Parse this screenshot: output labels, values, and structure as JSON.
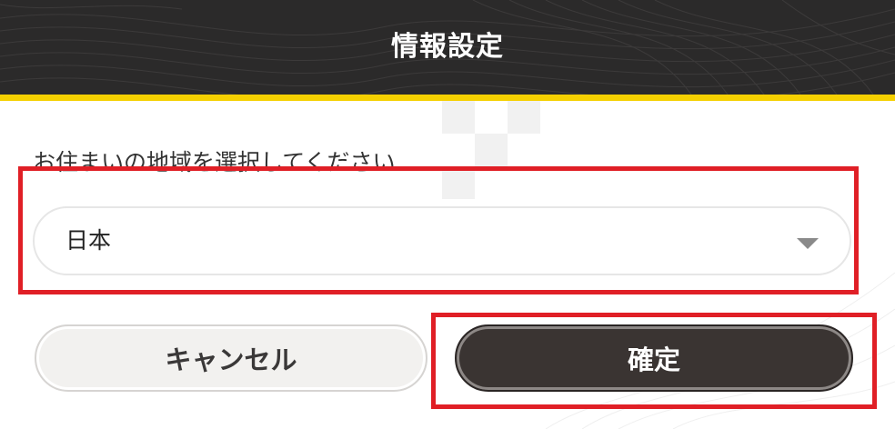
{
  "dialog": {
    "title": "情報設定",
    "prompt": "お住まいの地域を選択してください",
    "region_select": {
      "selected_value": "日本"
    },
    "buttons": {
      "cancel_label": "キャンセル",
      "confirm_label": "確定"
    }
  },
  "colors": {
    "header_bg": "#2b2a2a",
    "header_stripe": "#f5d000",
    "confirm_bg": "#3a3432",
    "cancel_bg": "#f2f1ef",
    "highlight": "#e01f26"
  }
}
